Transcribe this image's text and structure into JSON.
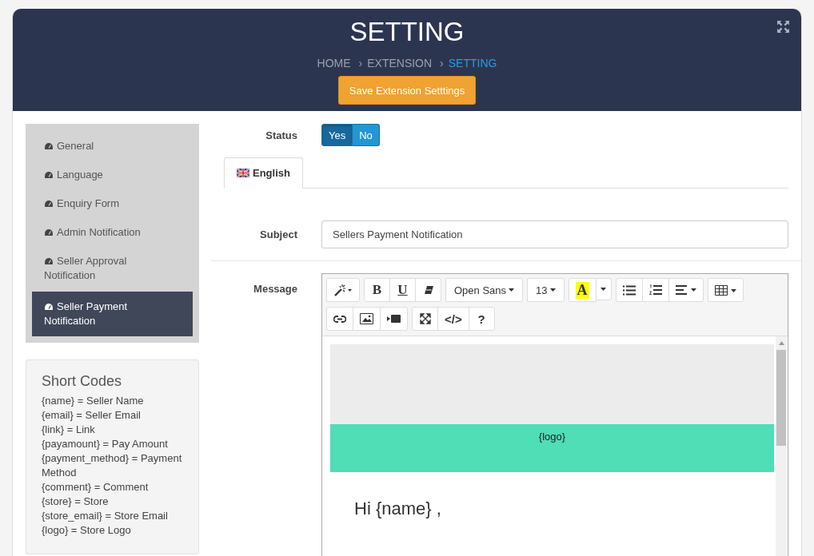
{
  "header": {
    "title": "SETTING",
    "breadcrumb": [
      {
        "label": "HOME",
        "selected": false
      },
      {
        "label": "EXTENSION",
        "separator": "›",
        "selected": false
      },
      {
        "label": "SETTING",
        "separator": "›",
        "selected": true
      }
    ],
    "save_button": "Save Extension Setttings"
  },
  "sidebar": {
    "items": [
      {
        "label": "General",
        "selected": false
      },
      {
        "label": "Language",
        "selected": false
      },
      {
        "label": "Enquiry Form",
        "selected": false
      },
      {
        "label": "Admin Notification",
        "selected": false
      },
      {
        "label": "Seller Approval Notification",
        "selected": false
      },
      {
        "label": "Seller Payment Notification",
        "selected": true
      }
    ]
  },
  "short_codes": {
    "title": "Short Codes",
    "lines": [
      "{name} = Seller Name",
      "{email} = Seller Email",
      "{link} = Link",
      "{payamount} = Pay Amount",
      "{payment_method} = Payment Method",
      "{comment} = Comment",
      "{store} = Store",
      "{store_email} = Store Email",
      "{logo} = Store Logo"
    ]
  },
  "form": {
    "status": {
      "label": "Status",
      "options": [
        {
          "label": "Yes",
          "selected": true
        },
        {
          "label": "No",
          "selected": false
        }
      ]
    },
    "tabs": [
      {
        "label": "English",
        "selected": true
      }
    ],
    "subject": {
      "label": "Subject",
      "value": "Sellers Payment Notification"
    },
    "message": {
      "label": "Message",
      "toolbar": [
        [
          {
            "kind": "wand"
          }
        ],
        [
          {
            "kind": "bold",
            "label": "B"
          },
          {
            "kind": "underline",
            "label": "U"
          },
          {
            "kind": "eraser"
          }
        ],
        [
          {
            "kind": "dropdown",
            "label": "Open Sans"
          }
        ],
        [
          {
            "kind": "dropdown",
            "label": "13"
          }
        ],
        [
          {
            "kind": "color",
            "label": "A"
          },
          {
            "kind": "caret"
          }
        ],
        [
          {
            "kind": "list"
          },
          {
            "kind": "ordered-list"
          },
          {
            "kind": "align"
          }
        ],
        [
          {
            "kind": "table"
          }
        ],
        [
          {
            "kind": "link"
          },
          {
            "kind": "picture"
          },
          {
            "kind": "video"
          }
        ],
        [
          {
            "kind": "fullscreen"
          },
          {
            "kind": "text",
            "label": "</>"
          },
          {
            "kind": "text",
            "label": "?"
          }
        ]
      ],
      "logo_placeholder": "{logo}",
      "greeting": "Hi {name} ,"
    }
  }
}
